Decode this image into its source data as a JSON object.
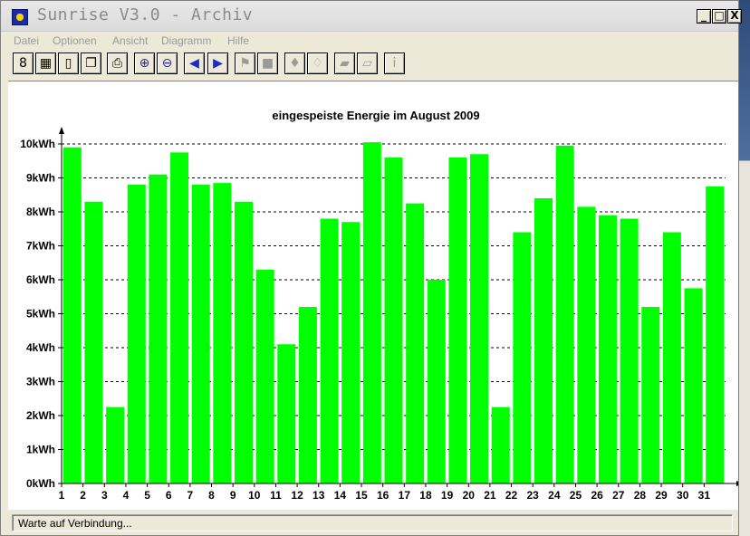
{
  "window": {
    "title": "Sunrise V3.0 - Archiv",
    "controls": {
      "minimize": "_",
      "maximize": "□",
      "close": "X"
    }
  },
  "menu": [
    "Datei",
    "Optionen",
    "Ansicht",
    "Diagramm",
    "Hilfe"
  ],
  "toolbar": [
    {
      "name": "inverter-icon",
      "glyph": "8"
    },
    {
      "name": "day-view-icon",
      "glyph": "▦"
    },
    {
      "name": "document-icon",
      "glyph": "▯"
    },
    {
      "name": "windows-icon",
      "glyph": "❐"
    },
    {
      "name": "printer-icon",
      "glyph": "⎙"
    },
    {
      "name": "zoom-in-icon",
      "glyph": "⊕"
    },
    {
      "name": "zoom-out-icon",
      "glyph": "⊖"
    },
    {
      "name": "previous-icon",
      "glyph": "◀"
    },
    {
      "name": "next-icon",
      "glyph": "▶"
    },
    {
      "name": "flag-icon",
      "glyph": "⚑"
    },
    {
      "name": "square-icon",
      "glyph": "■"
    },
    {
      "name": "pin-icon",
      "glyph": "♦"
    },
    {
      "name": "pin-off-icon",
      "glyph": "♢"
    },
    {
      "name": "folder-icon",
      "glyph": "▰"
    },
    {
      "name": "folder-check-icon",
      "glyph": "▱"
    },
    {
      "name": "info-icon",
      "glyph": "ⅰ"
    }
  ],
  "status": {
    "text": "Warte auf Verbindung..."
  },
  "colors": {
    "bar": "#00ff00",
    "grid": "#000000"
  },
  "chart_data": {
    "type": "bar",
    "title": "eingespeiste Energie im August 2009",
    "categories": [
      "1",
      "2",
      "3",
      "4",
      "5",
      "6",
      "7",
      "8",
      "9",
      "10",
      "11",
      "12",
      "13",
      "14",
      "15",
      "16",
      "17",
      "18",
      "19",
      "20",
      "21",
      "22",
      "23",
      "24",
      "25",
      "26",
      "27",
      "28",
      "29",
      "30",
      "31"
    ],
    "values": [
      9.9,
      8.3,
      2.25,
      8.8,
      9.1,
      9.75,
      8.8,
      8.85,
      8.3,
      6.3,
      4.1,
      5.2,
      7.8,
      7.7,
      10.05,
      9.6,
      8.25,
      6.0,
      9.6,
      9.7,
      2.25,
      7.4,
      8.4,
      9.95,
      8.15,
      7.9,
      7.8,
      5.2,
      7.4,
      5.75,
      8.75
    ],
    "y_ticks": [
      "0kWh",
      "1kWh",
      "2kWh",
      "3kWh",
      "4kWh",
      "5kWh",
      "6kWh",
      "7kWh",
      "8kWh",
      "9kWh",
      "10kWh"
    ],
    "ylim": [
      0,
      10
    ],
    "grid": true
  }
}
